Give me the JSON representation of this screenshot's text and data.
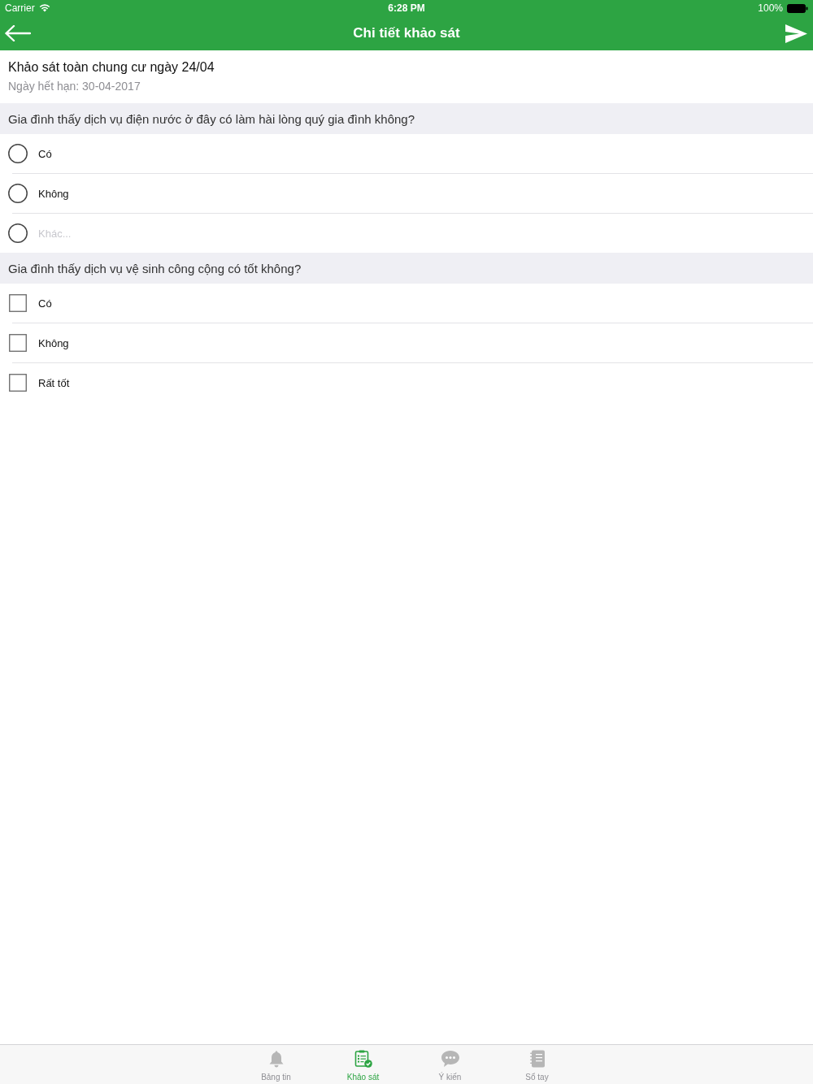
{
  "status_bar": {
    "carrier": "Carrier",
    "time": "6:28 PM",
    "battery": "100%"
  },
  "nav_bar": {
    "title": "Chi tiết khảo sát"
  },
  "survey": {
    "title": "Khảo sát toàn chung cư ngày 24/04",
    "expiry": "Ngày hết hạn: 30-04-2017"
  },
  "questions": [
    {
      "kind": "radio",
      "text": "Gia đình thấy dịch vụ điện nước ở đây có làm hài lòng quý gia đình không?",
      "options": [
        {
          "kind": "choice",
          "label": "Có",
          "selected": false
        },
        {
          "kind": "choice",
          "label": "Không",
          "selected": false
        },
        {
          "kind": "other",
          "placeholder": "Khác...",
          "selected": false
        }
      ]
    },
    {
      "kind": "checkbox",
      "text": "Gia đình thấy dịch vụ vệ sinh công cộng có tốt không?",
      "options": [
        {
          "kind": "choice",
          "label": "Có",
          "checked": false
        },
        {
          "kind": "choice",
          "label": "Không",
          "checked": false
        },
        {
          "kind": "choice",
          "label": "Rất tốt",
          "checked": false
        }
      ]
    }
  ],
  "tab_bar": [
    {
      "label": "Bảng tin",
      "selected": false
    },
    {
      "label": "Khảo sát",
      "selected": true
    },
    {
      "label": "Ý kiến",
      "selected": false
    },
    {
      "label": "Sổ tay",
      "selected": false
    }
  ]
}
